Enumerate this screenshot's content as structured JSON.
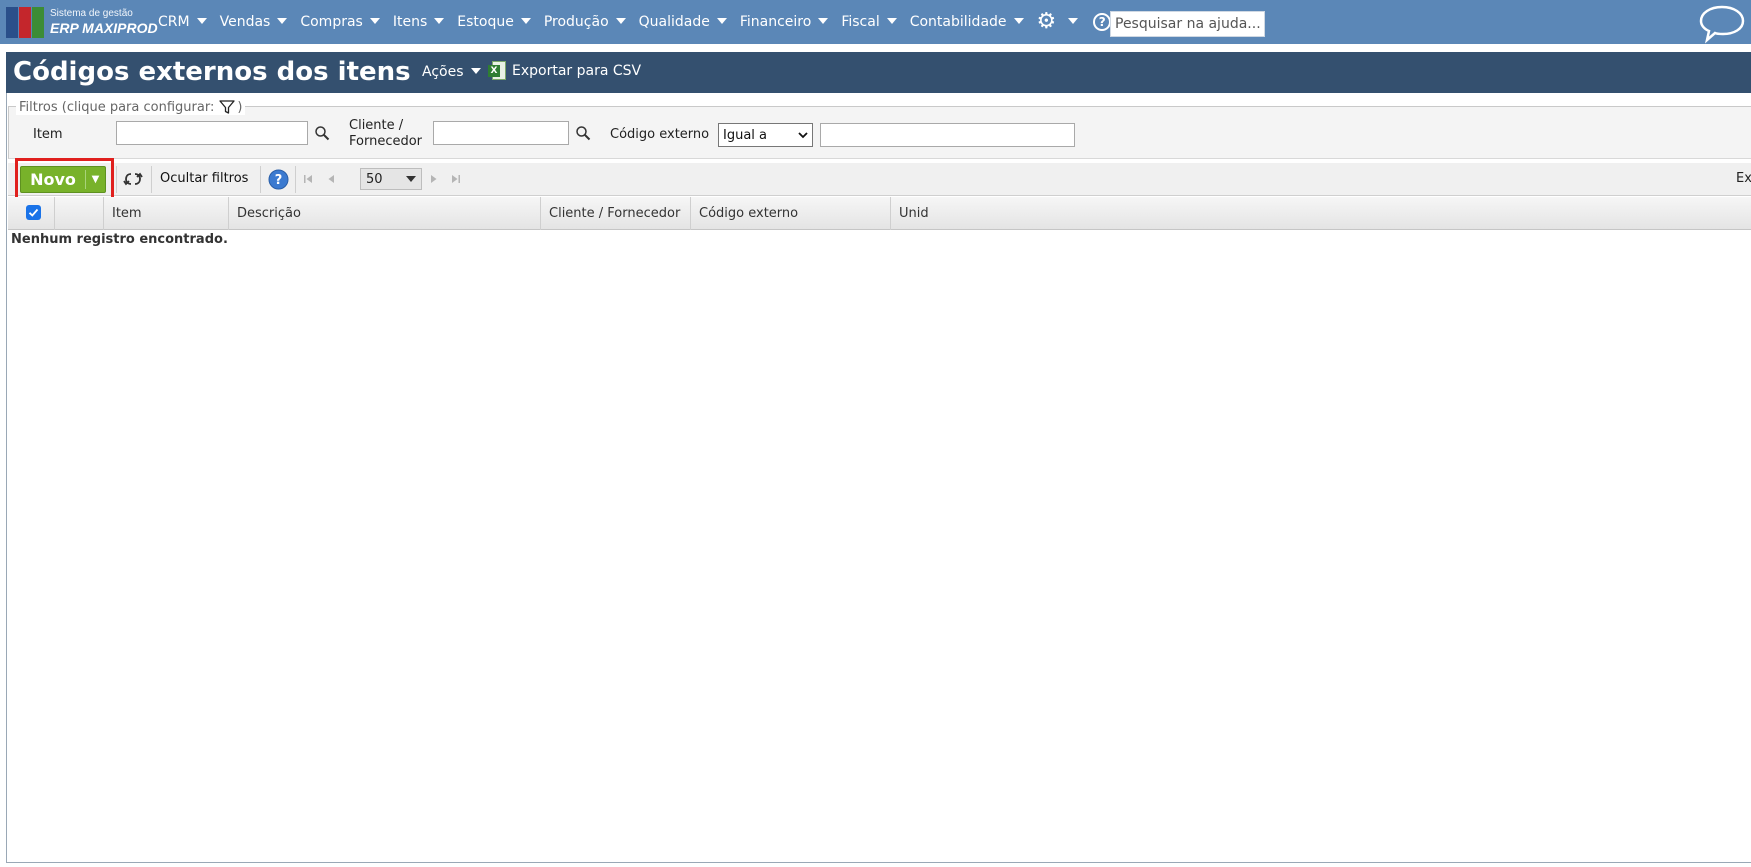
{
  "logo": {
    "line1": "Sistema de gestão",
    "line2": "ERP MAXIPROD"
  },
  "nav": {
    "items": [
      "CRM",
      "Vendas",
      "Compras",
      "Itens",
      "Estoque",
      "Produção",
      "Qualidade",
      "Financeiro",
      "Fiscal",
      "Contabilidade"
    ],
    "help_placeholder": "Pesquisar na ajuda..."
  },
  "page": {
    "title": "Códigos externos dos itens",
    "actions_label": "Ações",
    "export_label": "Exportar para CSV"
  },
  "filters": {
    "legend": "Filtros (clique para configurar:",
    "legend_close": ")",
    "item_label": "Item",
    "client_label_1": "Cliente /",
    "client_label_2": "Fornecedor",
    "code_label": "Código externo",
    "code_operator": "Igual a",
    "item_value": "",
    "client_value": "",
    "code_value": ""
  },
  "toolbar": {
    "new_label": "Novo",
    "hide_filters_label": "Ocultar filtros",
    "page_size": "50",
    "right_cut": "Ex"
  },
  "grid": {
    "columns": [
      "Item",
      "Descrição",
      "Cliente / Fornecedor",
      "Código externo",
      "Unid"
    ],
    "empty_message": "Nenhum registro encontrado."
  },
  "colors": {
    "topbar": "#5b87b7",
    "titlebar": "#34506f",
    "new_button": "#78b22a",
    "highlight": "#e0201e"
  }
}
